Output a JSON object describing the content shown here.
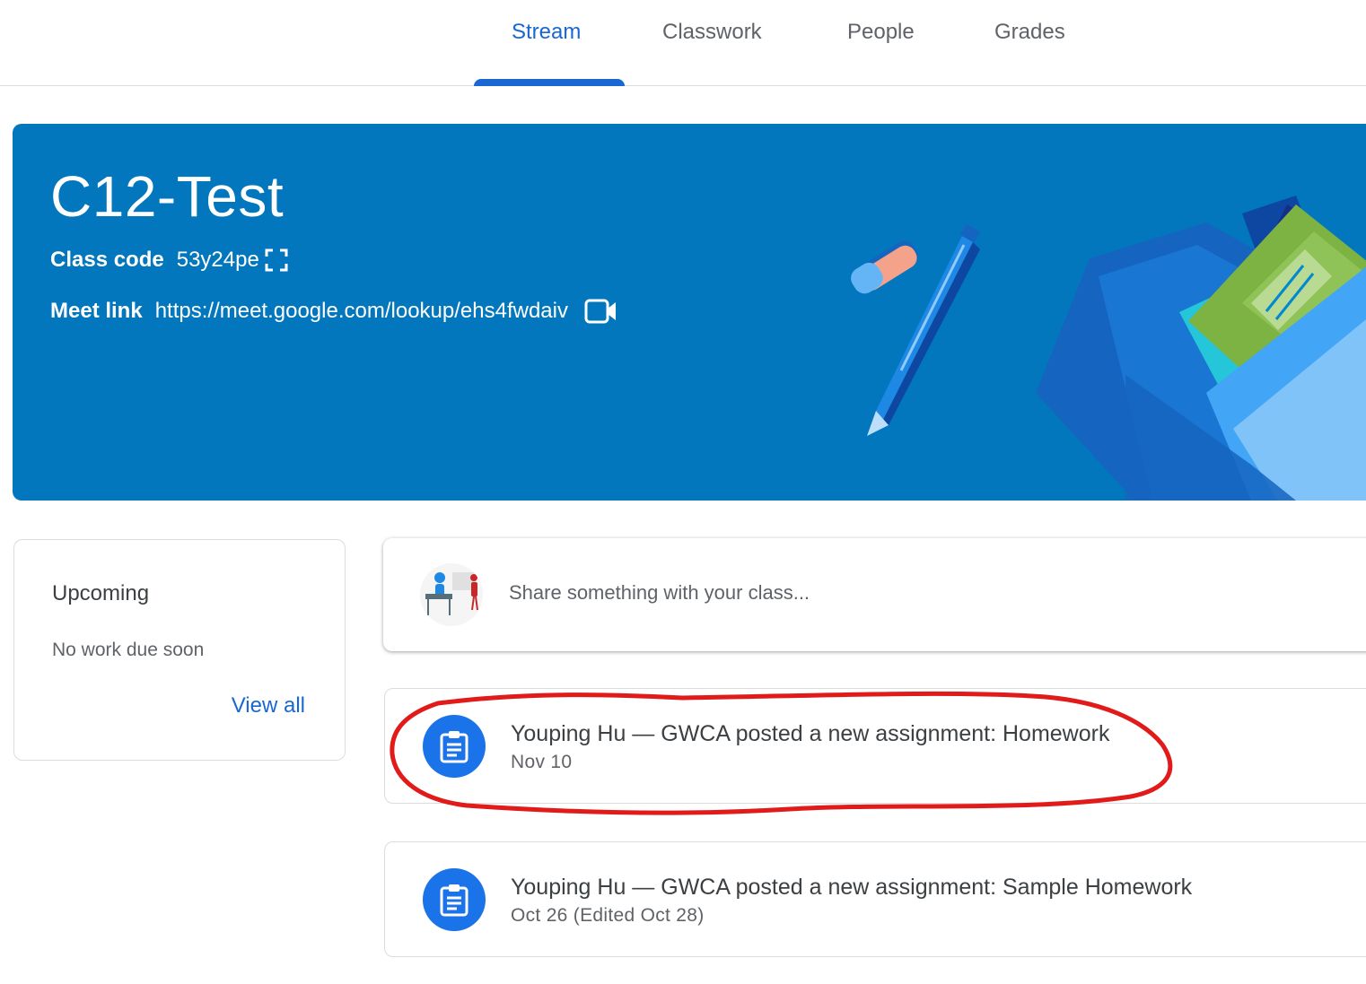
{
  "tabs": [
    {
      "label": "Stream",
      "active": true
    },
    {
      "label": "Classwork",
      "active": false
    },
    {
      "label": "People",
      "active": false
    },
    {
      "label": "Grades",
      "active": false
    }
  ],
  "banner": {
    "class_name": "C12-Test",
    "class_code_label": "Class code",
    "class_code": "53y24pe",
    "meet_link_label": "Meet link",
    "meet_link": "https://meet.google.com/lookup/ehs4fwdaiv",
    "background_color": "#0277bd"
  },
  "upcoming": {
    "title": "Upcoming",
    "empty_text": "No work due soon",
    "view_all": "View all"
  },
  "share_box": {
    "placeholder": "Share something with your class..."
  },
  "posts": [
    {
      "title": "Youping Hu — GWCA posted a new assignment: Homework",
      "date": "Nov 10",
      "icon": "assignment-icon",
      "highlighted": true
    },
    {
      "title": "Youping Hu — GWCA posted a new assignment: Sample Homework",
      "date": "Oct 26 (Edited Oct 28)",
      "icon": "assignment-icon",
      "highlighted": false
    }
  ],
  "colors": {
    "accent": "#1967d2",
    "assignment_icon_bg": "#1a73e8",
    "annotation": "#e11a1a"
  }
}
